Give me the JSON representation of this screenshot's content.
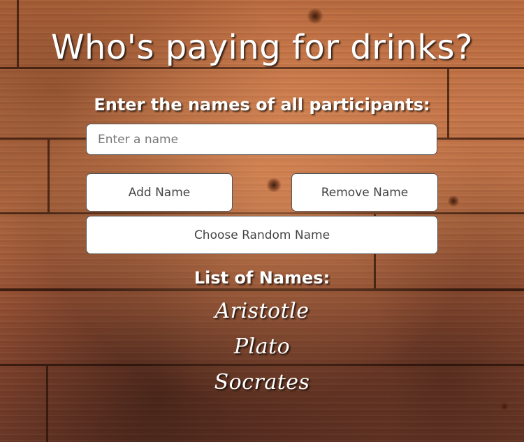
{
  "page": {
    "title": "Who's paying for drinks?",
    "subtitle": "Enter the names of all participants:"
  },
  "form": {
    "name_input": {
      "placeholder": "Enter a name",
      "value": ""
    },
    "add_button_label": "Add Name",
    "remove_button_label": "Remove Name",
    "random_button_label": "Choose Random Name"
  },
  "names": {
    "heading": "List of Names:",
    "items": [
      "Aristotle",
      "Plato",
      "Socrates"
    ]
  },
  "theme": {
    "text_color": "#ffffff",
    "button_background": "#ffffff",
    "button_text_color": "#444444",
    "background_wood": "#b0643a"
  }
}
